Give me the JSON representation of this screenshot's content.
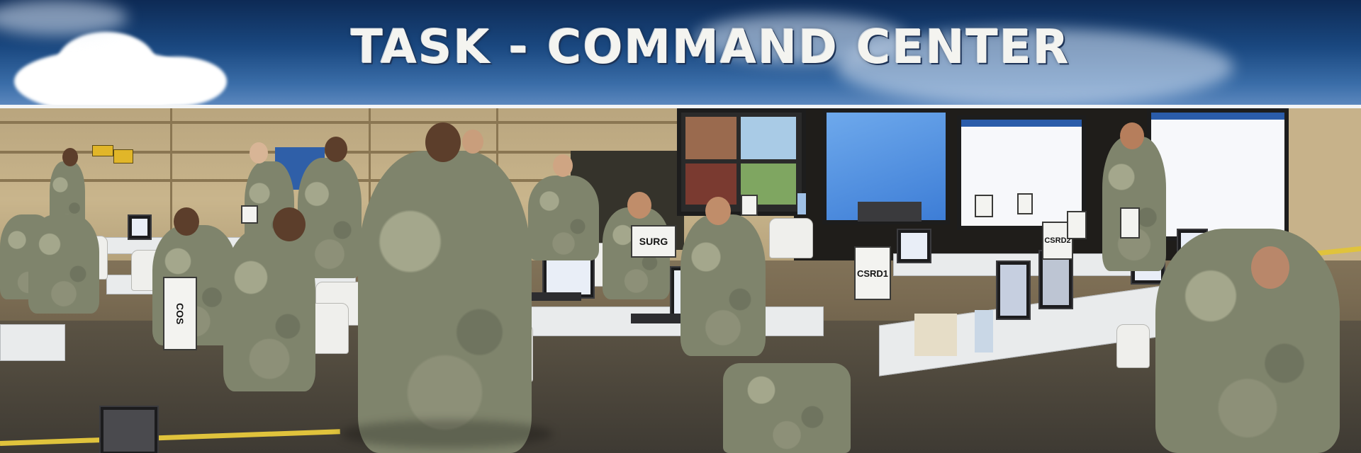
{
  "banner": {
    "title": "TASK - COMMAND CENTER"
  },
  "placards": {
    "surg": "SURG",
    "csrd1": "CSRD1",
    "csrd2": "CSRD2",
    "cos": "COS"
  },
  "colors": {
    "sky_top": "#0d2a55",
    "sky_bottom": "#5b87bd",
    "title_text": "#f4f4f0",
    "camouflage": "#7f846c",
    "floor_stripe": "#e0c33c"
  }
}
